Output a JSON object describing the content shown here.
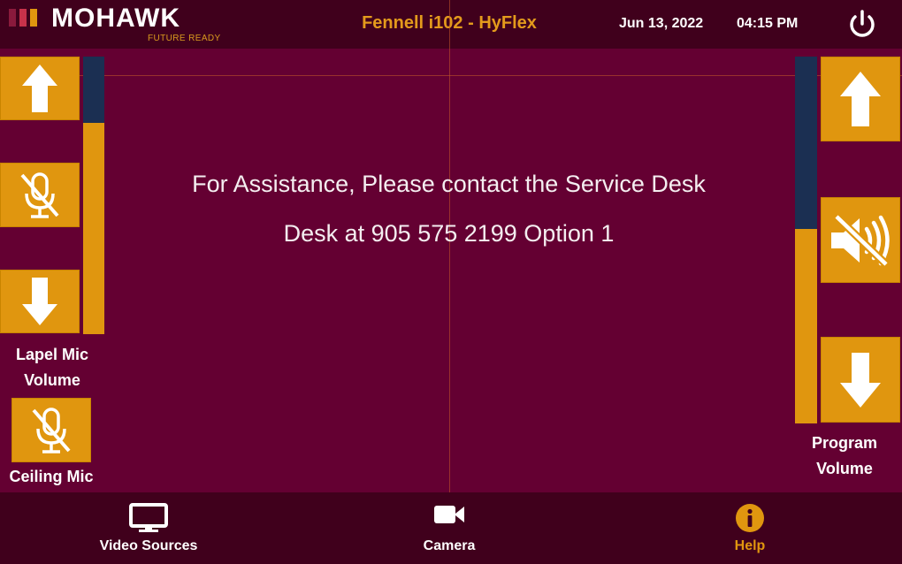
{
  "header": {
    "logo_text": "MOHAWK",
    "logo_tagline": "FUTURE READY",
    "room_title": "Fennell i102 - HyFlex",
    "date": "Jun 13, 2022",
    "time": "04:15 PM",
    "power_icon": "power-icon"
  },
  "colors": {
    "background": "#640032",
    "bar": "#40001c",
    "accent": "#e0960f",
    "meter_track": "#1b2f52",
    "title_accent": "#e39a1c",
    "logo_bars": [
      "#8a1a3c",
      "#c8324a",
      "#e0960f"
    ]
  },
  "lapel_mic": {
    "label_line1": "Lapel Mic",
    "label_line2": "Volume",
    "level": 0.76,
    "up_icon": "arrow-up-icon",
    "mute_icon": "microphone-muted-icon",
    "down_icon": "arrow-down-icon"
  },
  "ceiling_mic": {
    "label": "Ceiling Mic",
    "mute_icon": "microphone-muted-icon"
  },
  "program_volume": {
    "label_line1": "Program",
    "label_line2": "Volume",
    "level": 0.53,
    "up_icon": "arrow-up-icon",
    "mute_icon": "speaker-muted-icon",
    "down_icon": "arrow-down-icon"
  },
  "message": {
    "line1": "For Assistance, Please contact the Service Desk",
    "line2": "Desk at 905 575 2199 Option 1"
  },
  "footer": {
    "video_sources": {
      "label": "Video Sources",
      "icon": "monitor-icon"
    },
    "camera": {
      "label": "Camera",
      "icon": "video-camera-icon"
    },
    "help": {
      "label": "Help",
      "icon": "info-icon",
      "active": true
    }
  }
}
